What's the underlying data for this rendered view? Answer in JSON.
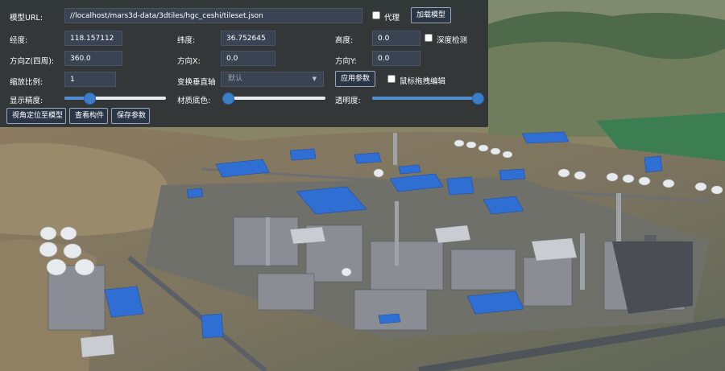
{
  "panel": {
    "model_url": {
      "label": "模型URL:",
      "value": "//localhost/mars3d-data/3dtiles/hgc_ceshi/tileset.json"
    },
    "proxy": {
      "label": "代理",
      "checked": false
    },
    "load_button": "加载模型",
    "longitude": {
      "label": "经度:",
      "value": "118.157112"
    },
    "latitude": {
      "label": "纬度:",
      "value": "36.752645"
    },
    "height": {
      "label": "高度:",
      "value": "0.0"
    },
    "depth_test": {
      "label": "深度检测",
      "checked": false
    },
    "heading": {
      "label": "方向Z(四周):",
      "value": "360.0"
    },
    "pitch": {
      "label": "方向X:",
      "value": "0.0"
    },
    "roll": {
      "label": "方向Y:",
      "value": "0.0"
    },
    "scale": {
      "label": "缩放比例:",
      "value": "1"
    },
    "up_axis": {
      "label": "变换垂直轴",
      "value": "默认"
    },
    "apply_button": "应用参数",
    "mouse_drag": {
      "label": "鼠标拖拽编辑",
      "checked": false
    },
    "precision": {
      "label": "显示精度:",
      "level": 0.24
    },
    "material_color": {
      "label": "材质底色:",
      "level": 0.02
    },
    "opacity": {
      "label": "透明度:",
      "level": 1.0
    },
    "locate_button": "视角定位至模型",
    "view_parts_button": "查看构件",
    "save_params_button": "保存参数"
  },
  "colors": {
    "panel_bg": "#262a30",
    "input_bg": "#3a4352",
    "slider_fill": "#4f8fd0",
    "slider_thumb": "#3b7dc6",
    "roof_blue": "#2f6fd4"
  }
}
